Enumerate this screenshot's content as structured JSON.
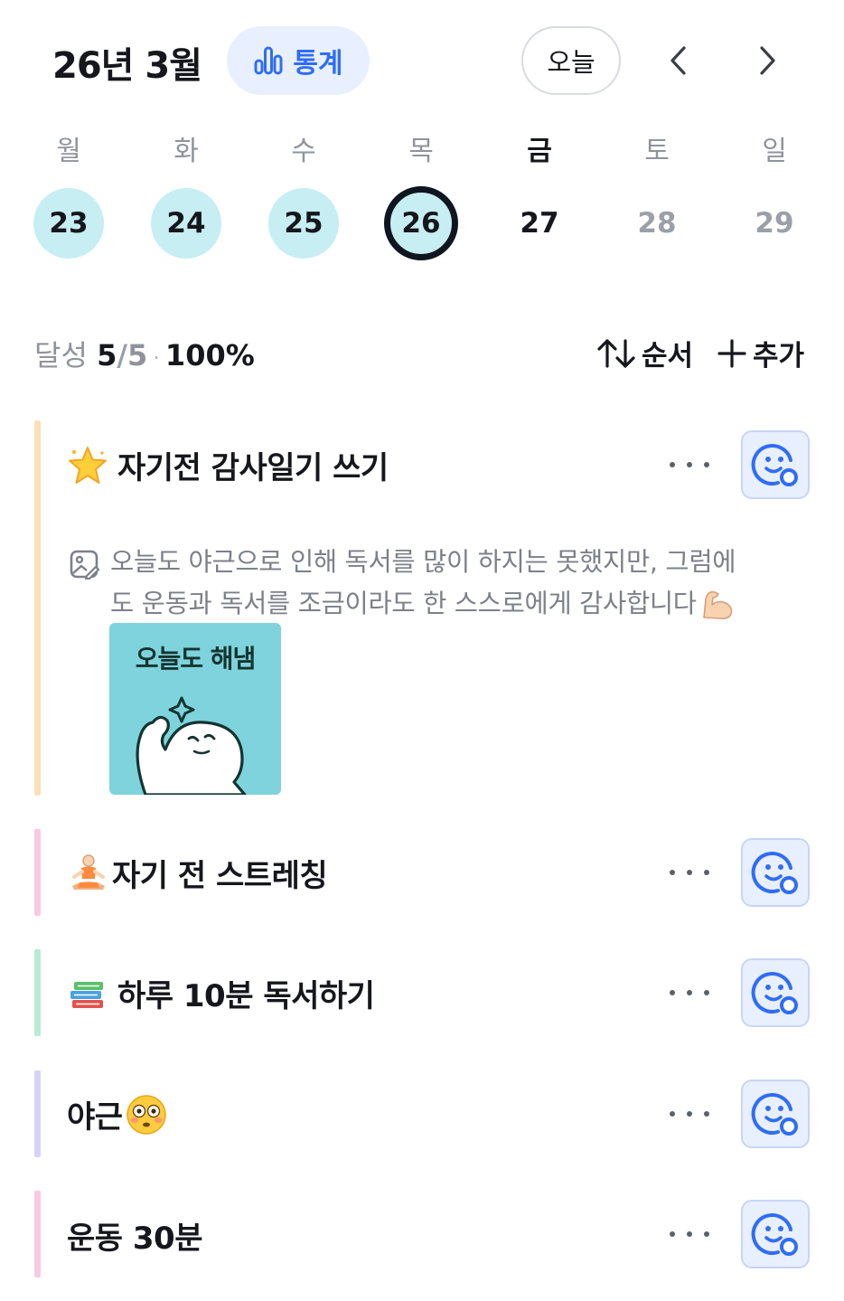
{
  "header": {
    "month_title": "26년 3월",
    "stats_label": "통계",
    "today_label": "오늘"
  },
  "week": {
    "weekdays": [
      "월",
      "화",
      "수",
      "목",
      "금",
      "토",
      "일"
    ],
    "days": [
      "23",
      "24",
      "25",
      "26",
      "27",
      "28",
      "29"
    ]
  },
  "summary": {
    "label": "달성",
    "done": "5",
    "total": "5",
    "percent": "100%"
  },
  "toolbar": {
    "order_label": "순서",
    "add_label": "추가"
  },
  "habits": [
    {
      "title": "자기전 감사일기 쓰기",
      "emoji": "star-icon",
      "bar_color": "#fbe0b8",
      "memo_line1": "오늘도 야근으로 인해 독서를 많이 하지는 못했지만, 그럼에",
      "memo_line2": "도 운동과 독서를 조금이라도 한 스스로에게 감사합니다",
      "sticker_text": "오늘도 해냄"
    },
    {
      "title": "자기 전 스트레칭",
      "emoji": "yoga-icon",
      "bar_color": "#f9c9e4"
    },
    {
      "title": "하루 10분 독서하기",
      "emoji": "books-icon",
      "bar_color": "#b7ecd4"
    },
    {
      "title": "야근",
      "emoji": "flushed-face-icon",
      "bar_color": "#d6d2f7"
    },
    {
      "title": "운동 30분",
      "emoji": "",
      "bar_color": "#f9c9e4"
    }
  ],
  "colors": {
    "accent": "#2f6df6",
    "done_day": "#c6eef3",
    "reaction_bg": "#e8efff"
  }
}
